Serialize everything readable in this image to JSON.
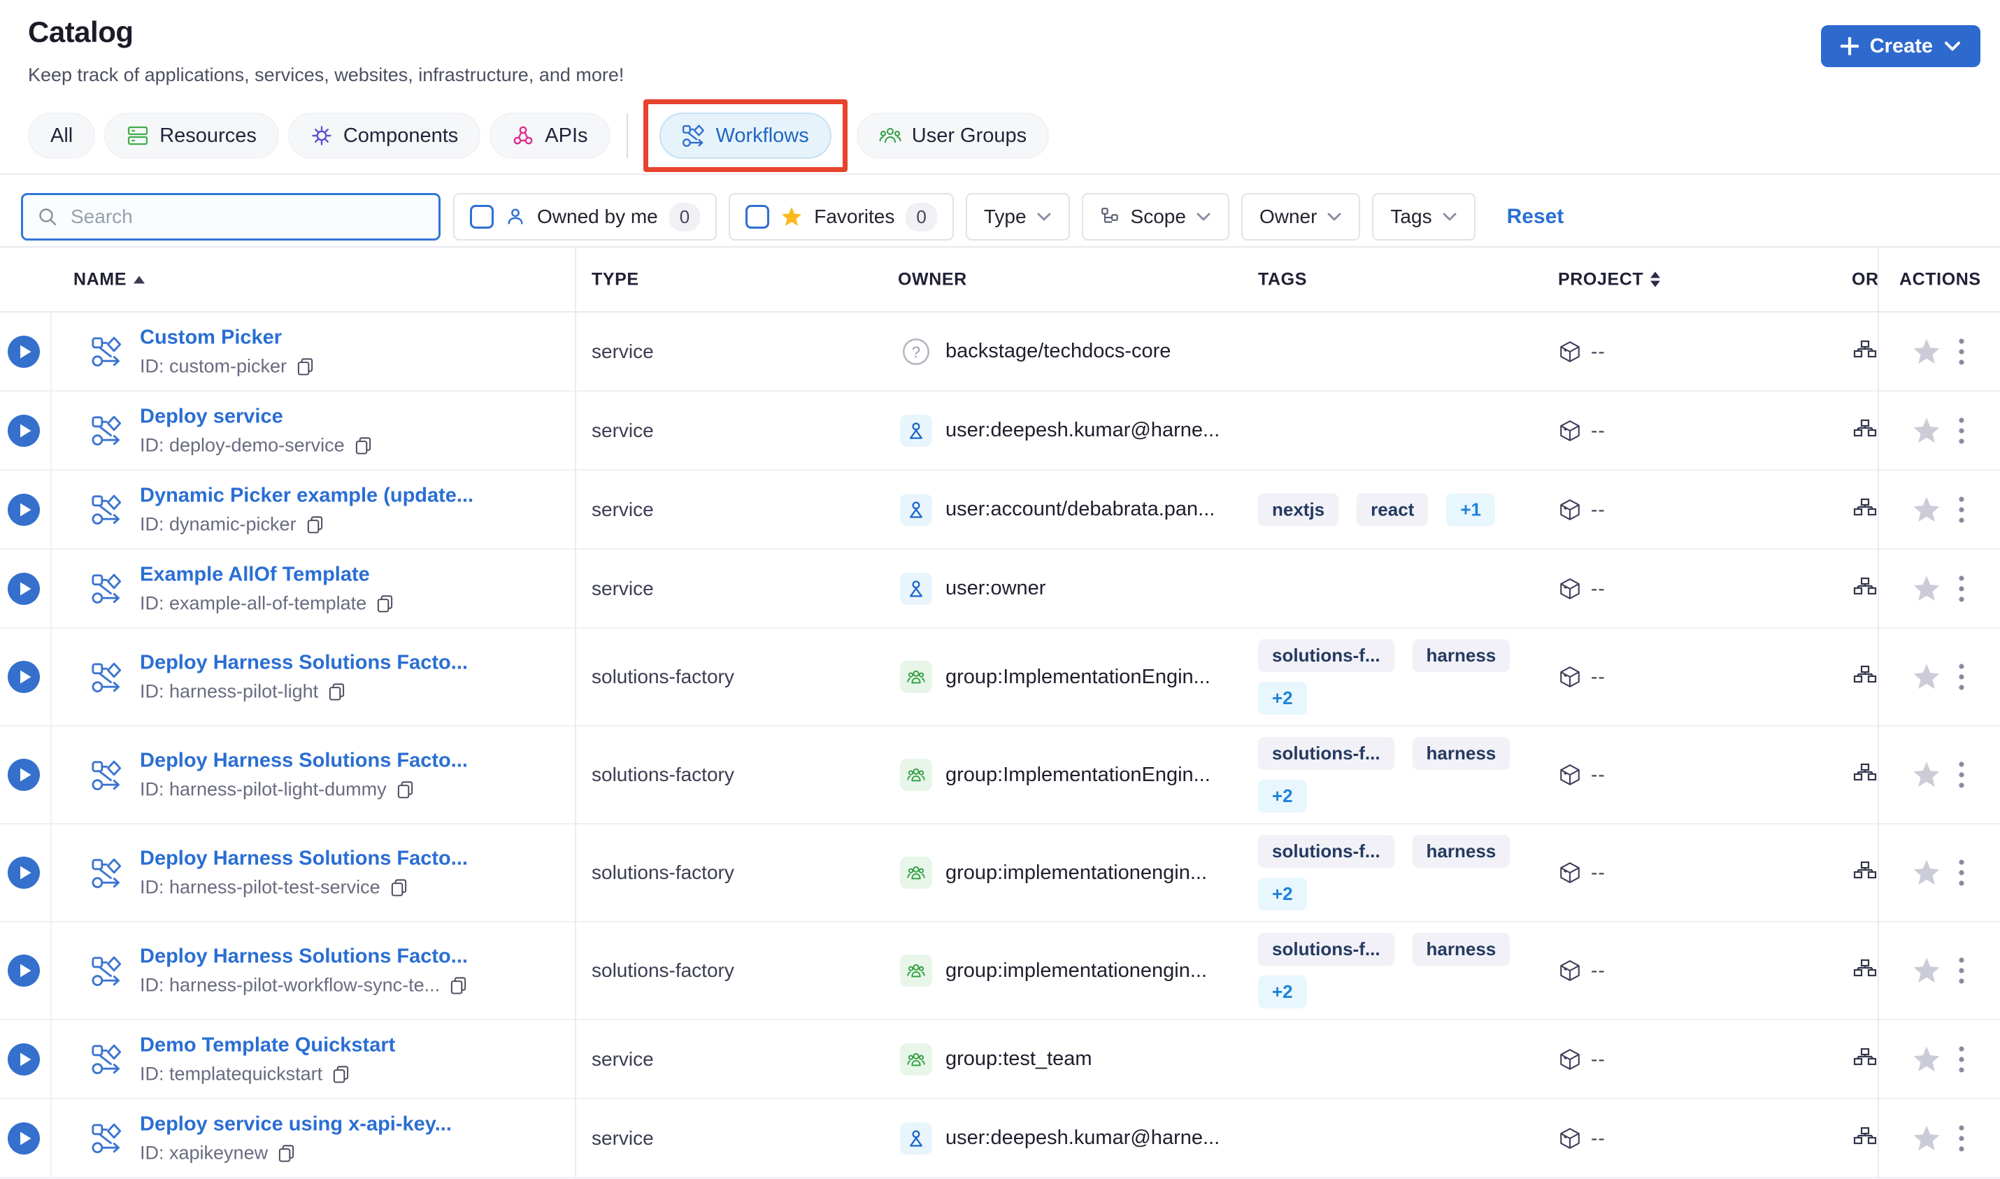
{
  "page": {
    "title": "Catalog",
    "subtitle": "Keep track of applications, services, websites, infrastructure, and more!"
  },
  "create_button": {
    "label": "Create"
  },
  "tabs": [
    {
      "label": "All"
    },
    {
      "label": "Resources"
    },
    {
      "label": "Components"
    },
    {
      "label": "APIs"
    },
    {
      "label": "Workflows",
      "active": true,
      "annotated": true
    },
    {
      "label": "User Groups"
    }
  ],
  "filters": {
    "search": {
      "placeholder": "Search"
    },
    "owned_by_me": {
      "label": "Owned by me",
      "count": "0"
    },
    "favorites": {
      "label": "Favorites",
      "count": "0"
    },
    "type": {
      "label": "Type"
    },
    "scope": {
      "label": "Scope"
    },
    "owner": {
      "label": "Owner"
    },
    "tags": {
      "label": "Tags"
    },
    "reset": {
      "label": "Reset"
    }
  },
  "table": {
    "columns": {
      "name": "NAME",
      "type": "TYPE",
      "owner": "OWNER",
      "tags": "TAGS",
      "project": "PROJECT",
      "org": "OR",
      "actions": "ACTIONS"
    },
    "rows": [
      {
        "name": "Custom Picker",
        "id": "ID: custom-picker",
        "type": "service",
        "owner": "backstage/techdocs-core",
        "owner_kind": "question",
        "tags": [],
        "project": "--"
      },
      {
        "name": "Deploy service",
        "id": "ID: deploy-demo-service",
        "type": "service",
        "owner": "user:deepesh.kumar@harne...",
        "owner_kind": "user",
        "tags": [],
        "project": "--"
      },
      {
        "name": "Dynamic Picker example (update...",
        "id": "ID: dynamic-picker",
        "type": "service",
        "owner": "user:account/debabrata.pan...",
        "owner_kind": "user",
        "tags": [
          "nextjs",
          "react"
        ],
        "more": "+1",
        "project": "--"
      },
      {
        "name": "Example AllOf Template",
        "id": "ID: example-all-of-template",
        "type": "service",
        "owner": "user:owner",
        "owner_kind": "user",
        "tags": [],
        "project": "--"
      },
      {
        "name": "Deploy Harness Solutions Facto...",
        "id": "ID: harness-pilot-light",
        "type": "solutions-factory",
        "owner": "group:ImplementationEngin...",
        "owner_kind": "group",
        "tags": [
          "solutions-f...",
          "harness"
        ],
        "more": "+2",
        "project": "--"
      },
      {
        "name": "Deploy Harness Solutions Facto...",
        "id": "ID: harness-pilot-light-dummy",
        "type": "solutions-factory",
        "owner": "group:ImplementationEngin...",
        "owner_kind": "group",
        "tags": [
          "solutions-f...",
          "harness"
        ],
        "more": "+2",
        "project": "--"
      },
      {
        "name": "Deploy Harness Solutions Facto...",
        "id": "ID: harness-pilot-test-service",
        "type": "solutions-factory",
        "owner": "group:implementationengin...",
        "owner_kind": "group",
        "tags": [
          "solutions-f...",
          "harness"
        ],
        "more": "+2",
        "project": "--"
      },
      {
        "name": "Deploy Harness Solutions Facto...",
        "id": "ID: harness-pilot-workflow-sync-te...",
        "type": "solutions-factory",
        "owner": "group:implementationengin...",
        "owner_kind": "group",
        "tags": [
          "solutions-f...",
          "harness"
        ],
        "more": "+2",
        "project": "--"
      },
      {
        "name": "Demo Template Quickstart",
        "id": "ID: templatequickstart",
        "type": "service",
        "owner": "group:test_team",
        "owner_kind": "group",
        "tags": [],
        "project": "--"
      },
      {
        "name": "Deploy service using x-api-key...",
        "id": "ID: xapikeynew",
        "type": "service",
        "owner": "user:deepesh.kumar@harne...",
        "owner_kind": "user",
        "tags": [],
        "project": "--"
      }
    ]
  },
  "colors": {
    "accent_blue": "#2e6ace",
    "link_blue": "#2a6ed3",
    "annotation_red": "#e8432d",
    "tag_more_blue": "#1d83da",
    "star_yellow": "#fdb81e",
    "icon_green": "#3fae4a",
    "icon_purple": "#5f50cf",
    "icon_magenta": "#dd2f8e",
    "icon_workflow_blue": "#3b74d1"
  }
}
